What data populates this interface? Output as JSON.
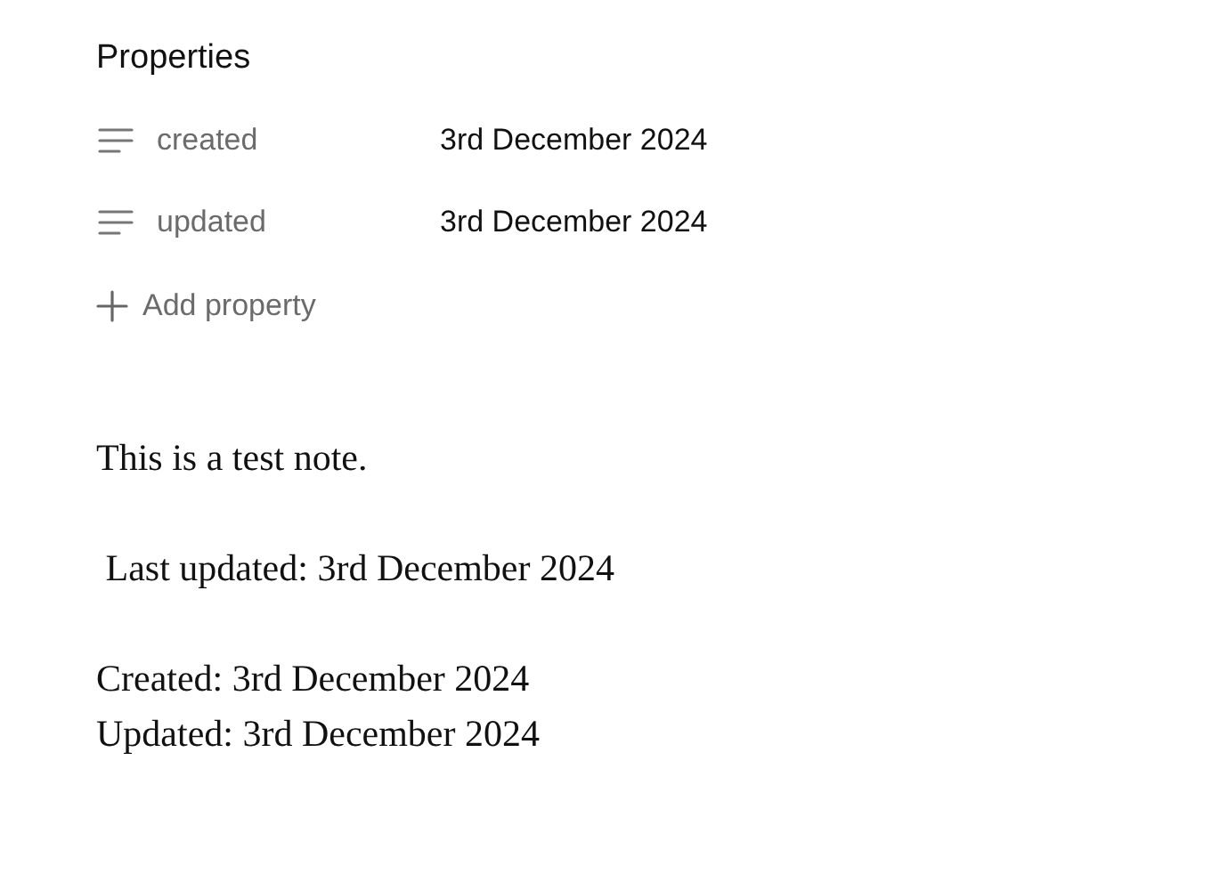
{
  "properties": {
    "title": "Properties",
    "items": [
      {
        "name": "created",
        "value": "3rd December 2024"
      },
      {
        "name": "updated",
        "value": "3rd December 2024"
      }
    ],
    "add_button": "Add property"
  },
  "body": {
    "paragraphs": [
      [
        "This is a test note."
      ],
      [
        " Last updated: 3rd December 2024"
      ],
      [
        "Created: 3rd December 2024",
        "Updated: 3rd December 2024"
      ]
    ]
  }
}
